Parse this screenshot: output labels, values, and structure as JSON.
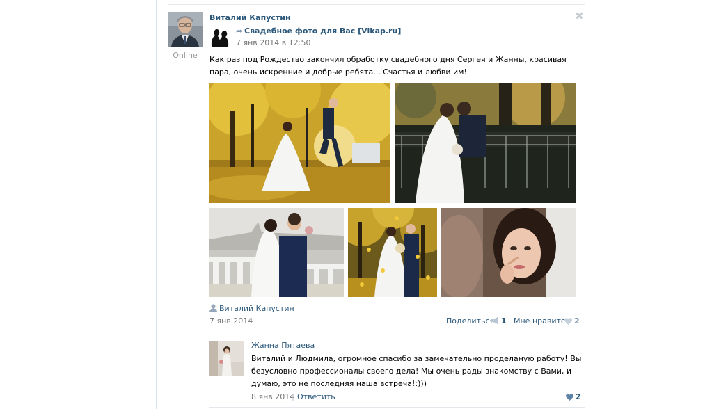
{
  "post": {
    "author": "Виталий Капустин",
    "online_status": "Online",
    "close_glyph": "✖",
    "repost": {
      "icon": "repost-arrow-icon",
      "group_name": "Свадебное фото для Вас [Vikap.ru]",
      "date": "7 янв 2014 в 12:50"
    },
    "text": "Как раз под Рождество закончил обработку свадебного дня Сергея и Жанны, красивая пара, очень искренние и добрые ребята... Счастья и любви им!",
    "photos": [
      "wedding-photo-autumn-park",
      "wedding-photo-kiss-bench",
      "wedding-photo-embankment",
      "wedding-photo-leaves-falling",
      "wedding-photo-bride-makeup"
    ],
    "footer": {
      "signed_by": "Виталий Капустин",
      "date": "7 янв 2014",
      "share_label": "Поделиться",
      "share_count": "1",
      "like_label": "Мне нравится",
      "like_count": "2"
    }
  },
  "comment": {
    "author": "Жанна Пятаева",
    "text": "Виталий и Людмила, огромное спасибо за замечательно проделаную работу! Вы безусловно профессионалы своего дела! Мы очень рады знакомству с Вами, и думаю, это не последняя наша встреча!:)))",
    "date": "8 янв 2014",
    "separator": "|",
    "reply_label": "Ответить",
    "like_count": "2"
  },
  "colors": {
    "link": "#2b587a",
    "muted": "#777777",
    "like_heart_inactive": "#c5d0db",
    "like_heart_active": "#5e82a8"
  }
}
